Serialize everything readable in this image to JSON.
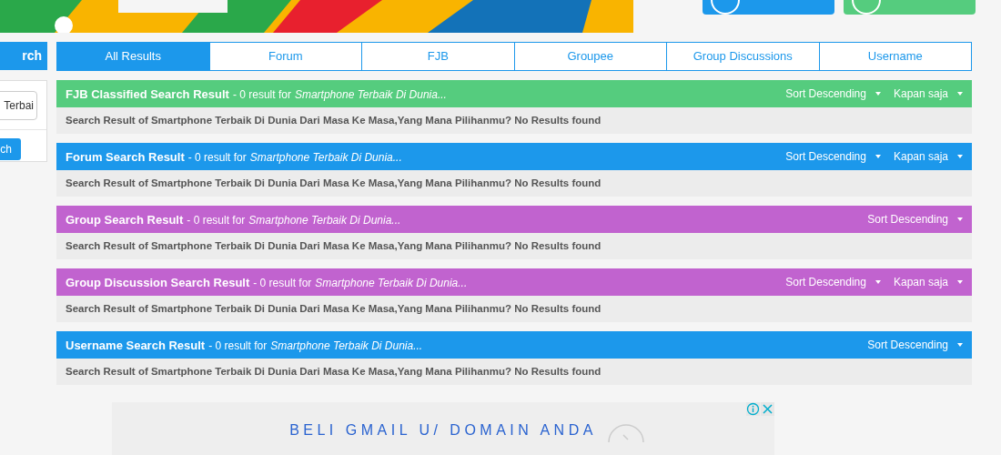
{
  "sidebar": {
    "header": "rch",
    "input_value": "Terbai",
    "button": "ch"
  },
  "tabs": [
    {
      "label": "All Results",
      "selected": true
    },
    {
      "label": "Forum",
      "selected": false
    },
    {
      "label": "FJB",
      "selected": false
    },
    {
      "label": "Groupee",
      "selected": false
    },
    {
      "label": "Group Discussions",
      "selected": false
    },
    {
      "label": "Username",
      "selected": false
    }
  ],
  "sections": [
    {
      "title": "FJB Classified Search Result",
      "count": "- 0 result for",
      "query": "Smartphone Terbaik Di Dunia...",
      "color": "#55cc7e",
      "sort": "Sort Descending",
      "time": "Kapan saja",
      "body": "Search Result of Smartphone Terbaik Di Dunia Dari Masa Ke Masa,Yang Mana Pilihanmu? No Results found"
    },
    {
      "title": "Forum Search Result",
      "count": "- 0 result for",
      "query": "Smartphone Terbaik Di Dunia...",
      "color": "#1c98eb",
      "sort": "Sort Descending",
      "time": "Kapan saja",
      "body": "Search Result of Smartphone Terbaik Di Dunia Dari Masa Ke Masa,Yang Mana Pilihanmu? No Results found"
    },
    {
      "title": "Group Search Result",
      "count": "- 0 result for",
      "query": "Smartphone Terbaik Di Dunia...",
      "color": "#c163cf",
      "sort": "Sort Descending",
      "body": "Search Result of Smartphone Terbaik Di Dunia Dari Masa Ke Masa,Yang Mana Pilihanmu? No Results found"
    },
    {
      "title": "Group Discussion Search Result",
      "count": "- 0 result for",
      "query": "Smartphone Terbaik Di Dunia...",
      "color": "#c163cf",
      "sort": "Sort Descending",
      "time": "Kapan saja",
      "body": "Search Result of Smartphone Terbaik Di Dunia Dari Masa Ke Masa,Yang Mana Pilihanmu? No Results found"
    },
    {
      "title": "Username Search Result",
      "count": "- 0 result for",
      "query": "Smartphone Terbaik Di Dunia...",
      "color": "#1c98eb",
      "sort": "Sort Descending",
      "body": "Search Result of Smartphone Terbaik Di Dunia Dari Masa Ke Masa,Yang Mana Pilihanmu? No Results found"
    }
  ],
  "ad": {
    "text": "BELI GMAIL U/ DOMAIN ANDA"
  }
}
